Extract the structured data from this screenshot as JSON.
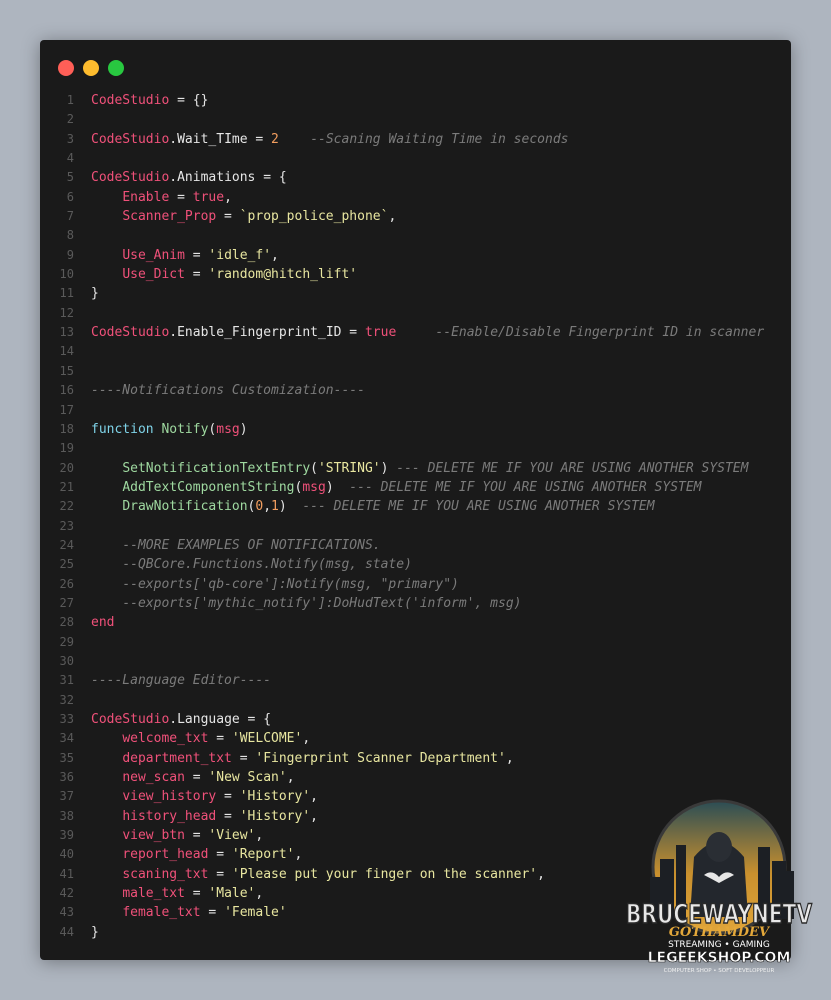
{
  "window": {
    "controls": [
      "close",
      "minimize",
      "maximize"
    ]
  },
  "editor": {
    "lines": [
      {
        "n": "1",
        "tokens": [
          [
            "v",
            "CodeStudio"
          ],
          [
            "o",
            " = {}"
          ]
        ]
      },
      {
        "n": "2",
        "tokens": []
      },
      {
        "n": "3",
        "tokens": [
          [
            "v",
            "CodeStudio"
          ],
          [
            "p",
            "."
          ],
          [
            "p",
            "Wait_TIme"
          ],
          [
            "o",
            " = "
          ],
          [
            "n",
            "2"
          ],
          [
            "p",
            "    "
          ],
          [
            "c",
            "--Scaning Waiting Time in seconds"
          ]
        ]
      },
      {
        "n": "4",
        "tokens": []
      },
      {
        "n": "5",
        "tokens": [
          [
            "v",
            "CodeStudio"
          ],
          [
            "p",
            "."
          ],
          [
            "p",
            "Animations"
          ],
          [
            "o",
            " = {"
          ]
        ]
      },
      {
        "n": "6",
        "tokens": [
          [
            "p",
            "    "
          ],
          [
            "v",
            "Enable"
          ],
          [
            "o",
            " = "
          ],
          [
            "k",
            "true"
          ],
          [
            "p",
            ","
          ]
        ]
      },
      {
        "n": "7",
        "tokens": [
          [
            "p",
            "    "
          ],
          [
            "v",
            "Scanner_Prop"
          ],
          [
            "o",
            " = "
          ],
          [
            "s",
            "`prop_police_phone`"
          ],
          [
            "p",
            ","
          ]
        ]
      },
      {
        "n": "8",
        "tokens": []
      },
      {
        "n": "9",
        "tokens": [
          [
            "p",
            "    "
          ],
          [
            "v",
            "Use_Anim"
          ],
          [
            "o",
            " = "
          ],
          [
            "s",
            "'idle_f'"
          ],
          [
            "p",
            ","
          ]
        ]
      },
      {
        "n": "10",
        "tokens": [
          [
            "p",
            "    "
          ],
          [
            "v",
            "Use_Dict"
          ],
          [
            "o",
            " = "
          ],
          [
            "s",
            "'random@hitch_lift'"
          ]
        ]
      },
      {
        "n": "11",
        "tokens": [
          [
            "p",
            "}"
          ]
        ]
      },
      {
        "n": "12",
        "tokens": []
      },
      {
        "n": "13",
        "tokens": [
          [
            "v",
            "CodeStudio"
          ],
          [
            "p",
            "."
          ],
          [
            "p",
            "Enable_Fingerprint_ID"
          ],
          [
            "o",
            " = "
          ],
          [
            "k",
            "true"
          ],
          [
            "p",
            "     "
          ],
          [
            "c",
            "--Enable/Disable Fingerprint ID in scanner"
          ]
        ]
      },
      {
        "n": "14",
        "tokens": []
      },
      {
        "n": "15",
        "tokens": []
      },
      {
        "n": "16",
        "tokens": [
          [
            "c",
            "----Notifications Customization----"
          ]
        ]
      },
      {
        "n": "17",
        "tokens": []
      },
      {
        "n": "18",
        "tokens": [
          [
            "kw",
            "function"
          ],
          [
            "p",
            " "
          ],
          [
            "f",
            "Notify"
          ],
          [
            "p",
            "("
          ],
          [
            "m",
            "msg"
          ],
          [
            "p",
            ")"
          ]
        ]
      },
      {
        "n": "19",
        "tokens": []
      },
      {
        "n": "20",
        "tokens": [
          [
            "p",
            "    "
          ],
          [
            "f",
            "SetNotificationTextEntry"
          ],
          [
            "p",
            "("
          ],
          [
            "s",
            "'STRING'"
          ],
          [
            "p",
            ") "
          ],
          [
            "c",
            "--- DELETE ME IF YOU ARE USING ANOTHER SYSTEM"
          ]
        ]
      },
      {
        "n": "21",
        "tokens": [
          [
            "p",
            "    "
          ],
          [
            "f",
            "AddTextComponentString"
          ],
          [
            "p",
            "("
          ],
          [
            "m",
            "msg"
          ],
          [
            "p",
            ")  "
          ],
          [
            "c",
            "--- DELETE ME IF YOU ARE USING ANOTHER SYSTEM"
          ]
        ]
      },
      {
        "n": "22",
        "tokens": [
          [
            "p",
            "    "
          ],
          [
            "f",
            "DrawNotification"
          ],
          [
            "p",
            "("
          ],
          [
            "n",
            "0"
          ],
          [
            "p",
            ","
          ],
          [
            "n",
            "1"
          ],
          [
            "p",
            ")  "
          ],
          [
            "c",
            "--- DELETE ME IF YOU ARE USING ANOTHER SYSTEM"
          ]
        ]
      },
      {
        "n": "23",
        "tokens": []
      },
      {
        "n": "24",
        "tokens": [
          [
            "p",
            "    "
          ],
          [
            "c",
            "--MORE EXAMPLES OF NOTIFICATIONS."
          ]
        ]
      },
      {
        "n": "25",
        "tokens": [
          [
            "p",
            "    "
          ],
          [
            "c",
            "--QBCore.Functions.Notify(msg, state)"
          ]
        ]
      },
      {
        "n": "26",
        "tokens": [
          [
            "p",
            "    "
          ],
          [
            "c",
            "--exports['qb-core']:Notify(msg, \"primary\")"
          ]
        ]
      },
      {
        "n": "27",
        "tokens": [
          [
            "p",
            "    "
          ],
          [
            "c",
            "--exports['mythic_notify']:DoHudText('inform', msg)"
          ]
        ]
      },
      {
        "n": "28",
        "tokens": [
          [
            "k",
            "end"
          ]
        ]
      },
      {
        "n": "29",
        "tokens": []
      },
      {
        "n": "30",
        "tokens": []
      },
      {
        "n": "31",
        "tokens": [
          [
            "c",
            "----Language Editor----"
          ]
        ]
      },
      {
        "n": "32",
        "tokens": []
      },
      {
        "n": "33",
        "tokens": [
          [
            "v",
            "CodeStudio"
          ],
          [
            "p",
            "."
          ],
          [
            "p",
            "Language"
          ],
          [
            "o",
            " = {"
          ]
        ]
      },
      {
        "n": "34",
        "tokens": [
          [
            "p",
            "    "
          ],
          [
            "v",
            "welcome_txt"
          ],
          [
            "o",
            " = "
          ],
          [
            "s",
            "'WELCOME'"
          ],
          [
            "p",
            ","
          ]
        ]
      },
      {
        "n": "35",
        "tokens": [
          [
            "p",
            "    "
          ],
          [
            "v",
            "department_txt"
          ],
          [
            "o",
            " = "
          ],
          [
            "s",
            "'Fingerprint Scanner Department'"
          ],
          [
            "p",
            ","
          ]
        ]
      },
      {
        "n": "36",
        "tokens": [
          [
            "p",
            "    "
          ],
          [
            "v",
            "new_scan"
          ],
          [
            "o",
            " = "
          ],
          [
            "s",
            "'New Scan'"
          ],
          [
            "p",
            ","
          ]
        ]
      },
      {
        "n": "37",
        "tokens": [
          [
            "p",
            "    "
          ],
          [
            "v",
            "view_history"
          ],
          [
            "o",
            " = "
          ],
          [
            "s",
            "'History'"
          ],
          [
            "p",
            ","
          ]
        ]
      },
      {
        "n": "38",
        "tokens": [
          [
            "p",
            "    "
          ],
          [
            "v",
            "history_head"
          ],
          [
            "o",
            " = "
          ],
          [
            "s",
            "'History'"
          ],
          [
            "p",
            ","
          ]
        ]
      },
      {
        "n": "39",
        "tokens": [
          [
            "p",
            "    "
          ],
          [
            "v",
            "view_btn"
          ],
          [
            "o",
            " = "
          ],
          [
            "s",
            "'View'"
          ],
          [
            "p",
            ","
          ]
        ]
      },
      {
        "n": "40",
        "tokens": [
          [
            "p",
            "    "
          ],
          [
            "v",
            "report_head"
          ],
          [
            "o",
            " = "
          ],
          [
            "s",
            "'Report'"
          ],
          [
            "p",
            ","
          ]
        ]
      },
      {
        "n": "41",
        "tokens": [
          [
            "p",
            "    "
          ],
          [
            "v",
            "scaning_txt"
          ],
          [
            "o",
            " = "
          ],
          [
            "s",
            "'Please put your finger on the scanner'"
          ],
          [
            "p",
            ","
          ]
        ]
      },
      {
        "n": "42",
        "tokens": [
          [
            "p",
            "    "
          ],
          [
            "v",
            "male_txt"
          ],
          [
            "o",
            " = "
          ],
          [
            "s",
            "'Male'"
          ],
          [
            "p",
            ","
          ]
        ]
      },
      {
        "n": "43",
        "tokens": [
          [
            "p",
            "    "
          ],
          [
            "v",
            "female_txt"
          ],
          [
            "o",
            " = "
          ],
          [
            "s",
            "'Female'"
          ]
        ]
      },
      {
        "n": "44",
        "tokens": [
          [
            "p",
            "}"
          ]
        ]
      }
    ]
  },
  "logo": {
    "title": "BRUCEWAYNETV",
    "subtitle": "GOTHAMDEV",
    "tagline": "STREAMING • GAMING",
    "site": "LEGEEKSHOP.COM",
    "footer": "COMPUTER SHOP • SOFT DEVELOPPEUR"
  }
}
